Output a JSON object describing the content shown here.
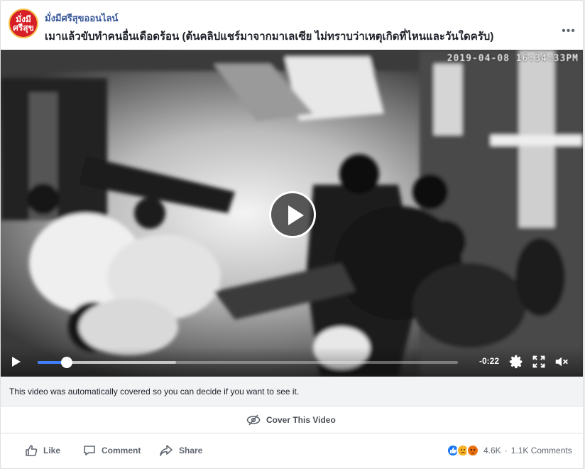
{
  "header": {
    "avatar_text": "มั่งมี ศรีสุข",
    "page_name": "มั่งมีศรีสุขออนไลน์",
    "post_title": "เมาแล้วขับทำคนอื่นเดือดร้อน (ต้นคลิปแชร์มาจากมาเลเซีย ไม่ทราบว่าเหตุเกิดที่ไหนและวันใดครับ)",
    "more_label": "•••"
  },
  "video": {
    "timestamp": "2019-04-08 16:34:33PM",
    "time_remaining": "-0:22",
    "progress": 0.07,
    "buffered": 0.33
  },
  "notice": {
    "text": "This video was automatically covered so you can decide if you want to see it."
  },
  "cover": {
    "label": "Cover This Video"
  },
  "actions": {
    "like": "Like",
    "comment": "Comment",
    "share": "Share"
  },
  "stats": {
    "reaction_count": "4.6K",
    "comment_count": "1.1K Comments",
    "separator": "·"
  },
  "colors": {
    "link": "#385898",
    "progress": "#4080ff",
    "like": "#1877f2",
    "angry": "#e9710f",
    "sad": "#f7b125"
  }
}
